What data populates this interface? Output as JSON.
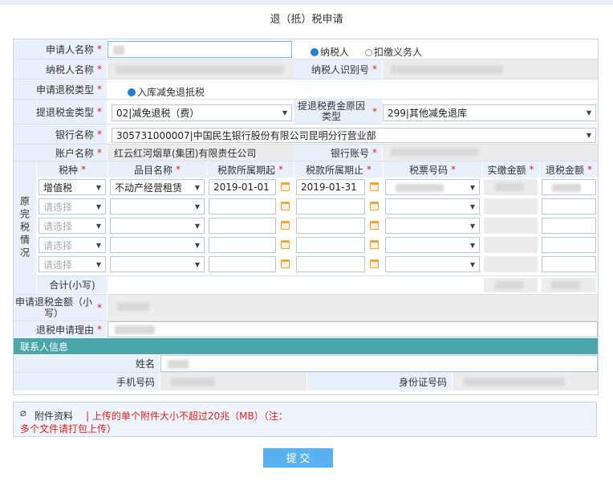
{
  "title": "退（抵）税申请",
  "form": {
    "applicant_label": "申请人名称",
    "taxpayer_radio": "纳税人",
    "withholding_radio": "扣缴义务人",
    "taxpayer_name_label": "纳税人名称",
    "taxpayer_id_label": "纳税人识别号",
    "refund_type_label": "申请退税类型",
    "refund_type_value": "入库减免退抵税",
    "tax_category_label": "提退税金类型",
    "tax_category_value": "02|减免退税（费）",
    "reason_label": "提退税费金原因类型",
    "reason_value": "299|其他减免退库",
    "bank_label": "银行名称",
    "bank_value": "305731000007|中国民生银行股份有限公司昆明分行营业部",
    "account_name_label": "账户名称",
    "account_name_value": "红云红河烟草(集团)有限责任公司",
    "account_no_label": "银行账号",
    "required_mark": "*"
  },
  "grid": {
    "side_label": "原完税情况",
    "headers": [
      "税种",
      "品目名称",
      "税款所属期起",
      "税款所属期止",
      "税票号码",
      "实缴金额",
      "退税金额"
    ],
    "row1": {
      "tax": "增值税",
      "item": "不动产经营租赁",
      "from": "2019-01-01",
      "to": "2019-01-31"
    },
    "placeholder": "请选择",
    "total_label": "合计(小写)"
  },
  "apply_amount_label": "申请退税金额（小写）",
  "apply_reason_label": "退税申请理由",
  "contact": {
    "section": "联系人信息",
    "name_label": "姓名",
    "phone_label": "手机号码",
    "id_label": "身份证号码"
  },
  "attachment": {
    "label": "附件资料",
    "note_line1": "| 上传的单个附件大小不超过20兆（MB）（注：",
    "note_line2": "多个文件请打包上传）"
  },
  "submit": "提 交",
  "colors": {
    "label_bg": "#e8f1fb",
    "teal": "#4aa6aa",
    "submit": "#5ab1ef",
    "required": "#e02020"
  }
}
